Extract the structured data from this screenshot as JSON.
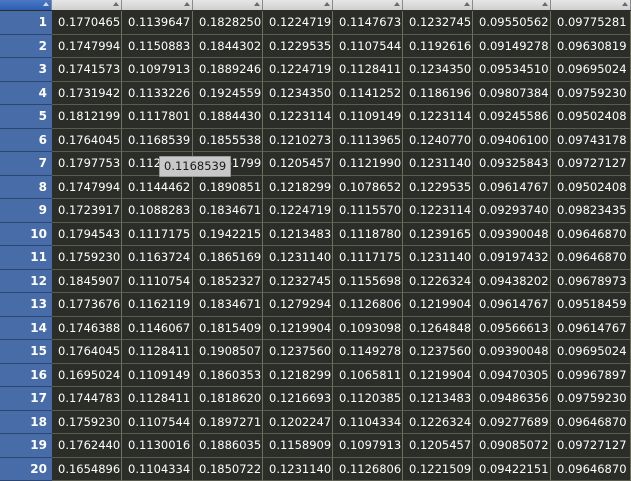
{
  "columns": [
    "",
    "",
    "",
    "",
    "",
    "",
    "",
    ""
  ],
  "tooltip": "0.1168539",
  "rows": [
    {
      "n": "1",
      "v": [
        "0.1770465",
        "0.1139647",
        "0.1828250",
        "0.1224719",
        "0.1147673",
        "0.1232745",
        "0.09550562",
        "0.09775281"
      ]
    },
    {
      "n": "2",
      "v": [
        "0.1747994",
        "0.1150883",
        "0.1844302",
        "0.1229535",
        "0.1107544",
        "0.1192616",
        "0.09149278",
        "0.09630819"
      ]
    },
    {
      "n": "3",
      "v": [
        "0.1741573",
        "0.1097913",
        "0.1889246",
        "0.1224719",
        "0.1128411",
        "0.1234350",
        "0.09534510",
        "0.09695024"
      ]
    },
    {
      "n": "4",
      "v": [
        "0.1731942",
        "0.1133226",
        "0.1924559",
        "0.1234350",
        "0.1141252",
        "0.1186196",
        "0.09807384",
        "0.09759230"
      ]
    },
    {
      "n": "5",
      "v": [
        "0.1812199",
        "0.1117801",
        "0.1884430",
        "0.1223114",
        "0.1109149",
        "0.1223114",
        "0.09245586",
        "0.09502408"
      ]
    },
    {
      "n": "6",
      "v": [
        "0.1764045",
        "0.1168539",
        "0.1855538",
        "0.1210273",
        "0.1113965",
        "0.1240770",
        "0.09406100",
        "0.09743178"
      ]
    },
    {
      "n": "7",
      "v": [
        "0.1797753",
        "0.112",
        "0.1861799",
        "0.1205457",
        "0.1121990",
        "0.1231140",
        "0.09325843",
        "0.09727127"
      ]
    },
    {
      "n": "8",
      "v": [
        "0.1747994",
        "0.1144462",
        "0.1890851",
        "0.1218299",
        "0.1078652",
        "0.1229535",
        "0.09614767",
        "0.09502408"
      ]
    },
    {
      "n": "9",
      "v": [
        "0.1723917",
        "0.1088283",
        "0.1834671",
        "0.1224719",
        "0.1115570",
        "0.1223114",
        "0.09293740",
        "0.09823435"
      ]
    },
    {
      "n": "10",
      "v": [
        "0.1794543",
        "0.1117175",
        "0.1942215",
        "0.1213483",
        "0.1118780",
        "0.1239165",
        "0.09390048",
        "0.09646870"
      ]
    },
    {
      "n": "11",
      "v": [
        "0.1759230",
        "0.1163724",
        "0.1865169",
        "0.1231140",
        "0.1117175",
        "0.1231140",
        "0.09197432",
        "0.09646870"
      ]
    },
    {
      "n": "12",
      "v": [
        "0.1845907",
        "0.1110754",
        "0.1852327",
        "0.1232745",
        "0.1155698",
        "0.1226324",
        "0.09438202",
        "0.09678973"
      ]
    },
    {
      "n": "13",
      "v": [
        "0.1773676",
        "0.1162119",
        "0.1834671",
        "0.1279294",
        "0.1126806",
        "0.1219904",
        "0.09614767",
        "0.09518459"
      ]
    },
    {
      "n": "14",
      "v": [
        "0.1746388",
        "0.1146067",
        "0.1815409",
        "0.1219904",
        "0.1093098",
        "0.1264848",
        "0.09566613",
        "0.09614767"
      ]
    },
    {
      "n": "15",
      "v": [
        "0.1764045",
        "0.1128411",
        "0.1908507",
        "0.1237560",
        "0.1149278",
        "0.1237560",
        "0.09390048",
        "0.09695024"
      ]
    },
    {
      "n": "16",
      "v": [
        "0.1695024",
        "0.1109149",
        "0.1860353",
        "0.1218299",
        "0.1065811",
        "0.1219904",
        "0.09470305",
        "0.09967897"
      ]
    },
    {
      "n": "17",
      "v": [
        "0.1744783",
        "0.1128411",
        "0.1818620",
        "0.1216693",
        "0.1120385",
        "0.1213483",
        "0.09486356",
        "0.09759230"
      ]
    },
    {
      "n": "18",
      "v": [
        "0.1759230",
        "0.1107544",
        "0.1897271",
        "0.1202247",
        "0.1104334",
        "0.1226324",
        "0.09277689",
        "0.09646870"
      ]
    },
    {
      "n": "19",
      "v": [
        "0.1762440",
        "0.1130016",
        "0.1886035",
        "0.1158909",
        "0.1097913",
        "0.1205457",
        "0.09085072",
        "0.09727127"
      ]
    },
    {
      "n": "20",
      "v": [
        "0.1654896",
        "0.1104334",
        "0.1850722",
        "0.1231140",
        "0.1126806",
        "0.1221509",
        "0.09422151",
        "0.09646870"
      ]
    }
  ]
}
